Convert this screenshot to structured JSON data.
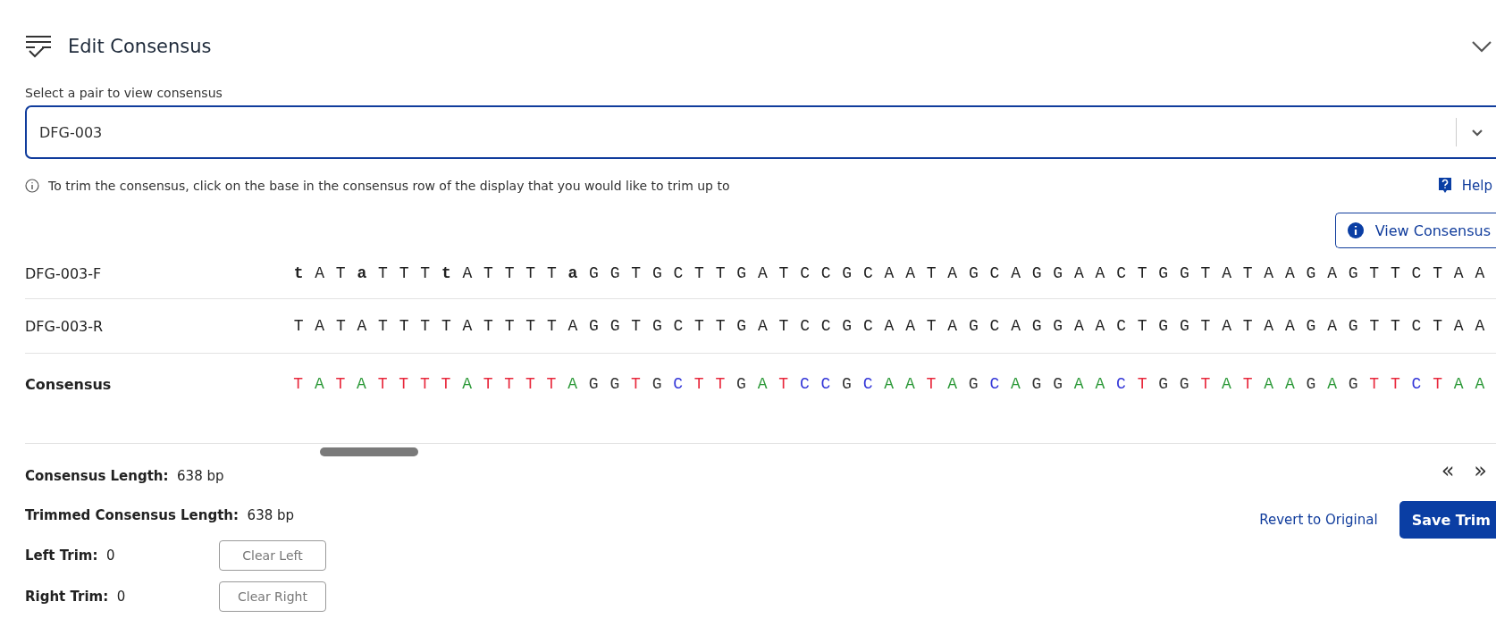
{
  "panel": {
    "title": "Edit Consensus"
  },
  "pair_select": {
    "label": "Select a pair to view consensus",
    "value": "DFG-003"
  },
  "info_text": "To trim the consensus, click on the base in the consensus row of the display that you would like to trim up to",
  "help_link": "Help",
  "view_consensus_button": "View Consensus",
  "rows": [
    {
      "name": "DFG-003-F",
      "kind": "read",
      "sequence": "**t**AT**a**TTT**t**ATTTT**a**GGTGCTTGATCCGCAATAGCAGGAACTGGTATAAGAGTTCTAA"
    },
    {
      "name": "DFG-003-R",
      "kind": "read",
      "sequence": "TATATTTTATTTTAGGTGCTTGATCCGCAATAGCAGGAACTGGTATAAGAGTTCTAA"
    },
    {
      "name": "Consensus",
      "kind": "consensus",
      "bases": [
        {
          "base": "T",
          "color": "#e8283c"
        },
        {
          "base": "A",
          "color": "#2e9a3a"
        },
        {
          "base": "T",
          "color": "#e8283c"
        },
        {
          "base": "A",
          "color": "#2e9a3a"
        },
        {
          "base": "T",
          "color": "#e8283c"
        },
        {
          "base": "T",
          "color": "#e8283c"
        },
        {
          "base": "T",
          "color": "#e8283c"
        },
        {
          "base": "T",
          "color": "#e8283c"
        },
        {
          "base": "A",
          "color": "#2e9a3a"
        },
        {
          "base": "T",
          "color": "#e8283c"
        },
        {
          "base": "T",
          "color": "#e8283c"
        },
        {
          "base": "T",
          "color": "#e8283c"
        },
        {
          "base": "T",
          "color": "#e8283c"
        },
        {
          "base": "A",
          "color": "#2e9a3a"
        },
        {
          "base": "G",
          "color": "#333333"
        },
        {
          "base": "G",
          "color": "#333333"
        },
        {
          "base": "T",
          "color": "#e8283c"
        },
        {
          "base": "G",
          "color": "#333333"
        },
        {
          "base": "C",
          "color": "#3437d8"
        },
        {
          "base": "T",
          "color": "#e8283c"
        },
        {
          "base": "T",
          "color": "#e8283c"
        },
        {
          "base": "G",
          "color": "#333333"
        },
        {
          "base": "A",
          "color": "#2e9a3a"
        },
        {
          "base": "T",
          "color": "#e8283c"
        },
        {
          "base": "C",
          "color": "#3437d8"
        },
        {
          "base": "C",
          "color": "#3437d8"
        },
        {
          "base": "G",
          "color": "#333333"
        },
        {
          "base": "C",
          "color": "#3437d8"
        },
        {
          "base": "A",
          "color": "#2e9a3a"
        },
        {
          "base": "A",
          "color": "#2e9a3a"
        },
        {
          "base": "T",
          "color": "#e8283c"
        },
        {
          "base": "A",
          "color": "#2e9a3a"
        },
        {
          "base": "G",
          "color": "#333333"
        },
        {
          "base": "C",
          "color": "#3437d8"
        },
        {
          "base": "A",
          "color": "#2e9a3a"
        },
        {
          "base": "G",
          "color": "#333333"
        },
        {
          "base": "G",
          "color": "#333333"
        },
        {
          "base": "A",
          "color": "#2e9a3a"
        },
        {
          "base": "A",
          "color": "#2e9a3a"
        },
        {
          "base": "C",
          "color": "#3437d8"
        },
        {
          "base": "T",
          "color": "#e8283c"
        },
        {
          "base": "G",
          "color": "#333333"
        },
        {
          "base": "G",
          "color": "#333333"
        },
        {
          "base": "T",
          "color": "#e8283c"
        },
        {
          "base": "A",
          "color": "#2e9a3a"
        },
        {
          "base": "T",
          "color": "#e8283c"
        },
        {
          "base": "A",
          "color": "#2e9a3a"
        },
        {
          "base": "A",
          "color": "#2e9a3a"
        },
        {
          "base": "G",
          "color": "#333333"
        },
        {
          "base": "A",
          "color": "#2e9a3a"
        },
        {
          "base": "G",
          "color": "#333333"
        },
        {
          "base": "T",
          "color": "#e8283c"
        },
        {
          "base": "T",
          "color": "#e8283c"
        },
        {
          "base": "C",
          "color": "#3437d8"
        },
        {
          "base": "T",
          "color": "#e8283c"
        },
        {
          "base": "A",
          "color": "#2e9a3a"
        },
        {
          "base": "A",
          "color": "#2e9a3a"
        }
      ]
    }
  ],
  "nav": {
    "previous": "«",
    "next": "»"
  },
  "stats": [
    {
      "label": "Consensus Length:",
      "value": "638 bp"
    },
    {
      "label": "Trimmed Consensus Length:",
      "value": "638 bp"
    }
  ],
  "revert_link": "Revert to Original",
  "save_button": "Save Trim",
  "trims": [
    {
      "label": "Left Trim:",
      "value": "0",
      "button": "Clear Left"
    },
    {
      "label": "Right Trim:",
      "value": "0",
      "button": "Clear Right"
    }
  ]
}
